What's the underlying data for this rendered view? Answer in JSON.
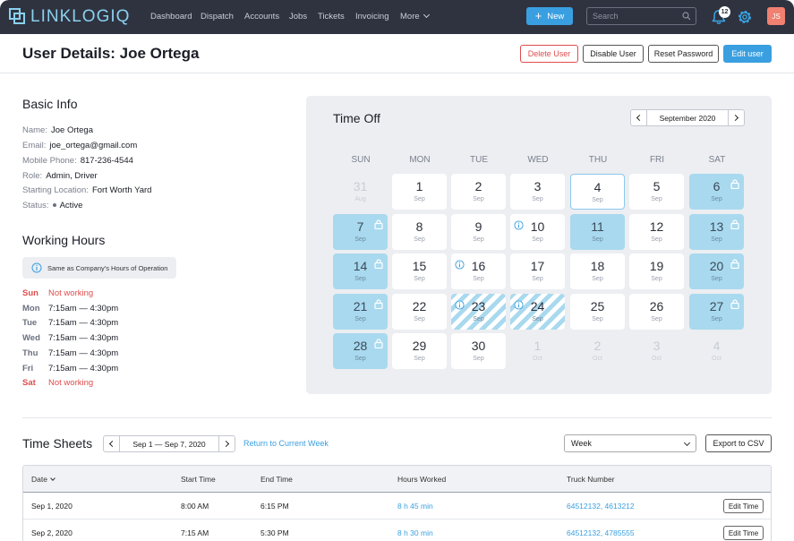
{
  "app": {
    "logo_text": "LINKLOGIQ"
  },
  "nav": {
    "links": [
      "Dashboard",
      "Dispatch",
      "Accounts",
      "Jobs",
      "Tickets",
      "Invoicing",
      "More"
    ],
    "new_label": "New",
    "search_placeholder": "Search",
    "notification_count": "12",
    "avatar_initials": "JS",
    "icons": {
      "search": "search-icon",
      "bell": "bell-icon",
      "settings": "gear-icon"
    },
    "colors": {
      "nav_bg": "#2f3340",
      "accent": "#3a9fe0",
      "avatar": "#f08070"
    }
  },
  "header": {
    "title": "User Details: Joe Ortega",
    "buttons": {
      "delete": "Delete User",
      "disable": "Disable User",
      "reset": "Reset Password",
      "edit": "Edit user"
    }
  },
  "basic_info": {
    "heading": "Basic Info",
    "fields": [
      {
        "label": "Name:",
        "value": "Joe Ortega"
      },
      {
        "label": "Email:",
        "value": "joe_ortega@gmail.com"
      },
      {
        "label": "Mobile Phone:",
        "value": "817-236-4544"
      },
      {
        "label": "Role:",
        "value": "Admin, Driver"
      },
      {
        "label": "Starting Location:",
        "value": "Fort Worth Yard"
      },
      {
        "label": "Status:",
        "value": "Active"
      }
    ]
  },
  "working_hours": {
    "heading": "Working Hours",
    "note": "Same as Company's Hours of Operation",
    "days": [
      {
        "day": "Sun",
        "hours": "Not working",
        "off": true
      },
      {
        "day": "Mon",
        "hours": "7:15am — 4:30pm",
        "off": false
      },
      {
        "day": "Tue",
        "hours": "7:15am — 4:30pm",
        "off": false
      },
      {
        "day": "Wed",
        "hours": "7:15am — 4:30pm",
        "off": false
      },
      {
        "day": "Thu",
        "hours": "7:15am — 4:30pm",
        "off": false
      },
      {
        "day": "Fri",
        "hours": "7:15am — 4:30pm",
        "off": false
      },
      {
        "day": "Sat",
        "hours": "Not working",
        "off": true
      }
    ]
  },
  "time_off": {
    "title": "Time Off",
    "month_label": "September 2020",
    "weekdays": [
      "SUN",
      "MON",
      "TUE",
      "WED",
      "THU",
      "FRI",
      "SAT"
    ],
    "cells": [
      {
        "num": "31",
        "mon": "Aug",
        "state": "out",
        "lock": false,
        "info": false
      },
      {
        "num": "1",
        "mon": "Sep",
        "state": "normal",
        "lock": false,
        "info": false
      },
      {
        "num": "2",
        "mon": "Sep",
        "state": "normal",
        "lock": false,
        "info": false
      },
      {
        "num": "3",
        "mon": "Sep",
        "state": "normal",
        "lock": false,
        "info": false
      },
      {
        "num": "4",
        "mon": "Sep",
        "state": "today",
        "lock": false,
        "info": false
      },
      {
        "num": "5",
        "mon": "Sep",
        "state": "normal",
        "lock": false,
        "info": false
      },
      {
        "num": "6",
        "mon": "Sep",
        "state": "blue",
        "lock": true,
        "info": false
      },
      {
        "num": "7",
        "mon": "Sep",
        "state": "blue",
        "lock": true,
        "info": false
      },
      {
        "num": "8",
        "mon": "Sep",
        "state": "normal",
        "lock": false,
        "info": false
      },
      {
        "num": "9",
        "mon": "Sep",
        "state": "normal",
        "lock": false,
        "info": false
      },
      {
        "num": "10",
        "mon": "Sep",
        "state": "normal",
        "lock": false,
        "info": true
      },
      {
        "num": "11",
        "mon": "Sep",
        "state": "blue",
        "lock": false,
        "info": false
      },
      {
        "num": "12",
        "mon": "Sep",
        "state": "normal",
        "lock": false,
        "info": false
      },
      {
        "num": "13",
        "mon": "Sep",
        "state": "blue",
        "lock": true,
        "info": false
      },
      {
        "num": "14",
        "mon": "Sep",
        "state": "blue",
        "lock": true,
        "info": false
      },
      {
        "num": "15",
        "mon": "Sep",
        "state": "normal",
        "lock": false,
        "info": false
      },
      {
        "num": "16",
        "mon": "Sep",
        "state": "normal",
        "lock": false,
        "info": true
      },
      {
        "num": "17",
        "mon": "Sep",
        "state": "normal",
        "lock": false,
        "info": false
      },
      {
        "num": "18",
        "mon": "Sep",
        "state": "normal",
        "lock": false,
        "info": false
      },
      {
        "num": "19",
        "mon": "Sep",
        "state": "normal",
        "lock": false,
        "info": false
      },
      {
        "num": "20",
        "mon": "Sep",
        "state": "blue",
        "lock": true,
        "info": false
      },
      {
        "num": "21",
        "mon": "Sep",
        "state": "blue",
        "lock": true,
        "info": false
      },
      {
        "num": "22",
        "mon": "Sep",
        "state": "normal",
        "lock": false,
        "info": false
      },
      {
        "num": "23",
        "mon": "Sep",
        "state": "striped",
        "lock": false,
        "info": true
      },
      {
        "num": "24",
        "mon": "Sep",
        "state": "striped",
        "lock": false,
        "info": true
      },
      {
        "num": "25",
        "mon": "Sep",
        "state": "normal",
        "lock": false,
        "info": false
      },
      {
        "num": "26",
        "mon": "Sep",
        "state": "normal",
        "lock": false,
        "info": false
      },
      {
        "num": "27",
        "mon": "Sep",
        "state": "blue",
        "lock": true,
        "info": false
      },
      {
        "num": "28",
        "mon": "Sep",
        "state": "blue",
        "lock": true,
        "info": false
      },
      {
        "num": "29",
        "mon": "Sep",
        "state": "normal",
        "lock": false,
        "info": false
      },
      {
        "num": "30",
        "mon": "Sep",
        "state": "normal",
        "lock": false,
        "info": false
      },
      {
        "num": "1",
        "mon": "Oct",
        "state": "out",
        "lock": false,
        "info": false
      },
      {
        "num": "2",
        "mon": "Oct",
        "state": "out",
        "lock": false,
        "info": false
      },
      {
        "num": "3",
        "mon": "Oct",
        "state": "out",
        "lock": false,
        "info": false
      },
      {
        "num": "4",
        "mon": "Oct",
        "state": "out",
        "lock": false,
        "info": false
      }
    ]
  },
  "time_sheets": {
    "title": "Time Sheets",
    "range_label": "Sep 1 — Sep 7, 2020",
    "return_link": "Return to Current Week",
    "view_select": "Week",
    "export_label": "Export to CSV",
    "columns": [
      "Date",
      "Start Time",
      "End Time",
      "Hours Worked",
      "Truck Number"
    ],
    "rows": [
      {
        "date": "Sep 1, 2020",
        "start": "8:00 AM",
        "end": "6:15 PM",
        "hours": "8 h 45 min",
        "truck": "64512132, 4613212",
        "action": "Edit Time"
      },
      {
        "date": "Sep 2, 2020",
        "start": "7:15 AM",
        "end": "5:30 PM",
        "hours": "8 h 30 min",
        "truck": "64512132, 4785555",
        "action": "Edit Time"
      }
    ]
  }
}
